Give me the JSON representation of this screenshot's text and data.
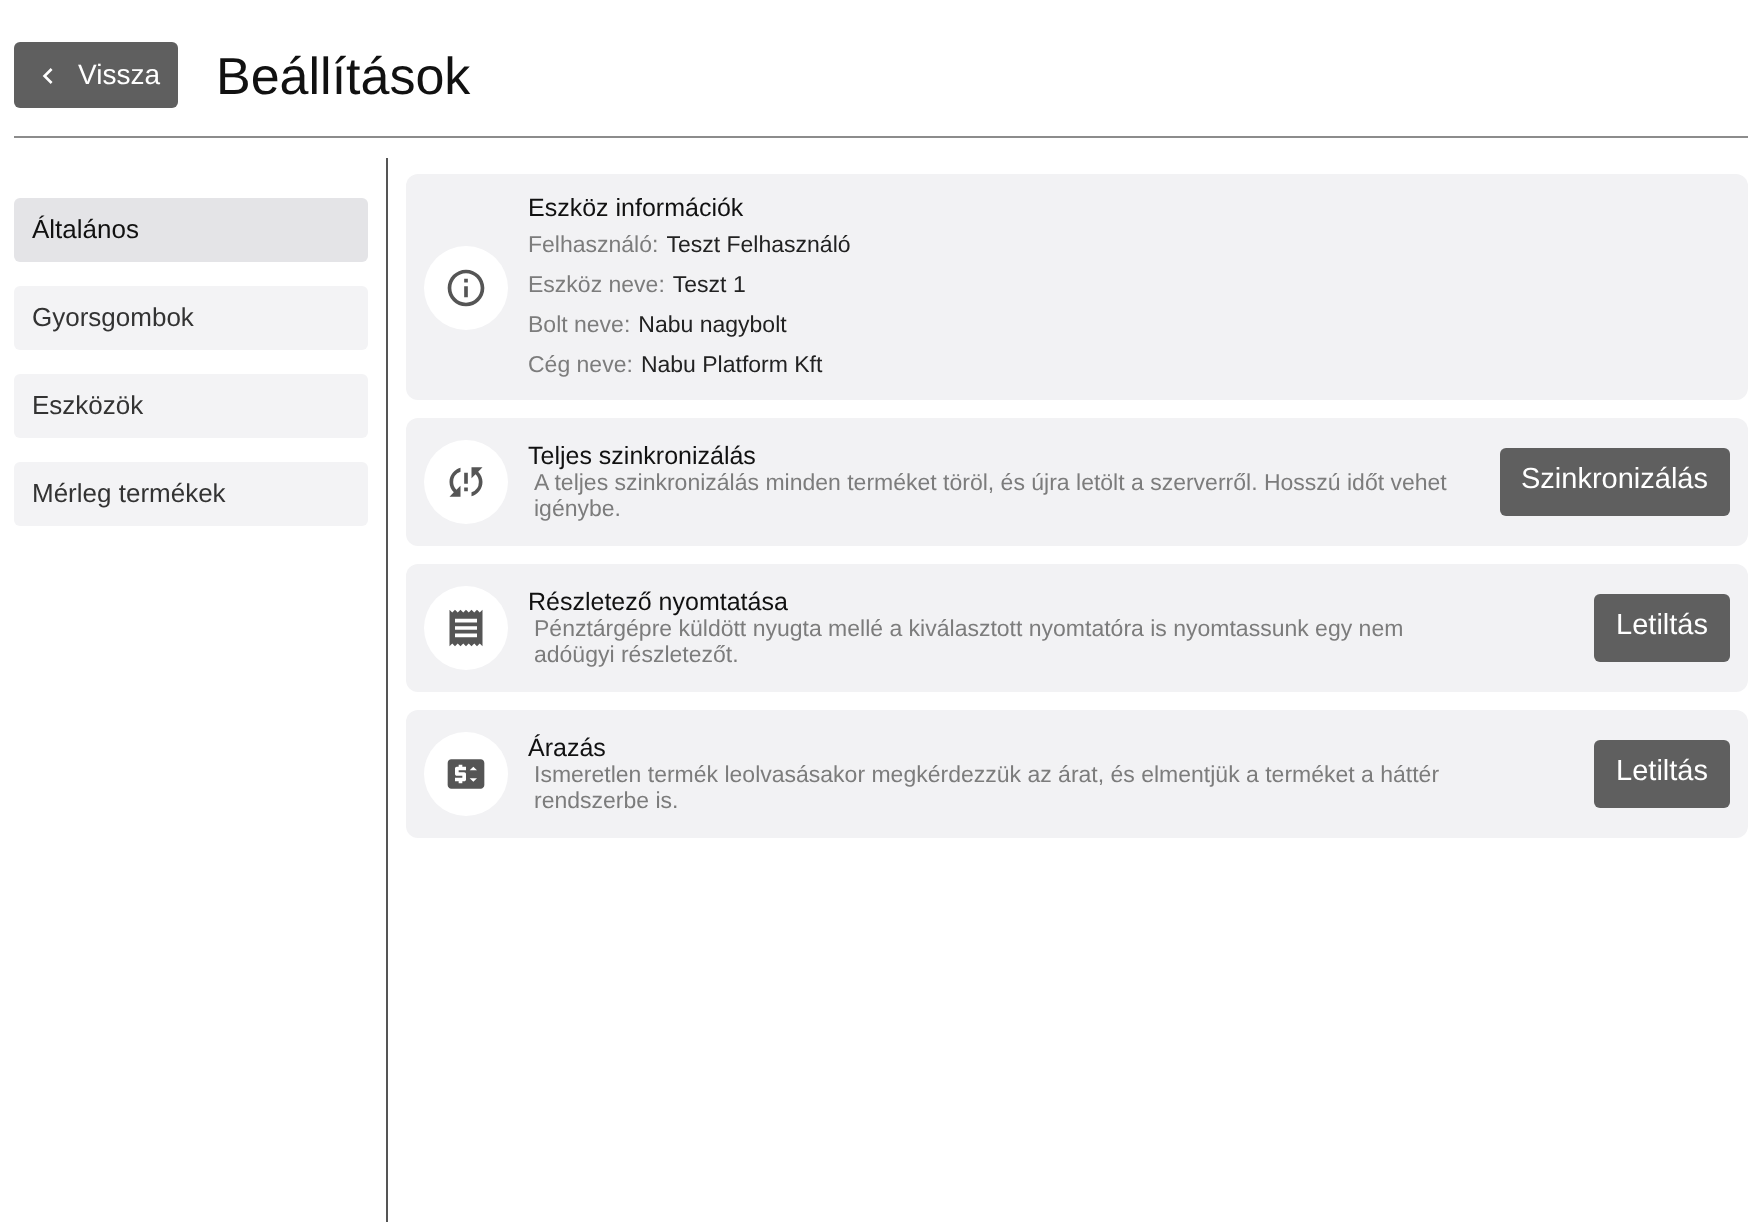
{
  "header": {
    "back_button": "Vissza",
    "title": "Beállítások"
  },
  "sidebar": {
    "items": [
      {
        "label": "Általános",
        "selected": true
      },
      {
        "label": "Gyorsgombok",
        "selected": false
      },
      {
        "label": "Eszközök",
        "selected": false
      },
      {
        "label": "Mérleg termékek",
        "selected": false
      }
    ]
  },
  "device_info": {
    "title": "Eszköz információk",
    "fields": [
      {
        "label": "Felhasználó:",
        "value": "Teszt Felhasználó"
      },
      {
        "label": "Eszköz neve:",
        "value": "Teszt 1"
      },
      {
        "label": "Bolt neve:",
        "value": "Nabu nagybolt"
      },
      {
        "label": "Cég neve:",
        "value": "Nabu Platform Kft"
      }
    ]
  },
  "settings": [
    {
      "kind": "sync",
      "title": "Teljes szinkronizálás",
      "description": "A teljes szinkronizálás minden terméket töröl, és újra letölt a szerverről. Hosszú időt vehet igénybe.",
      "button": "Szinkronizálás"
    },
    {
      "kind": "receipt",
      "title": "Részletező nyomtatása",
      "description": "Pénztárgépre küldött nyugta mellé a kiválasztott nyomtatóra is nyomtassunk egy nem adóügyi részletezőt.",
      "button": "Letiltás"
    },
    {
      "kind": "price",
      "title": "Árazás",
      "description": "Ismeretlen termék leolvasásakor megkérdezzük az árat, és elmentjük a terméket a háttér rendszerbe is.",
      "button": "Letiltás"
    }
  ]
}
